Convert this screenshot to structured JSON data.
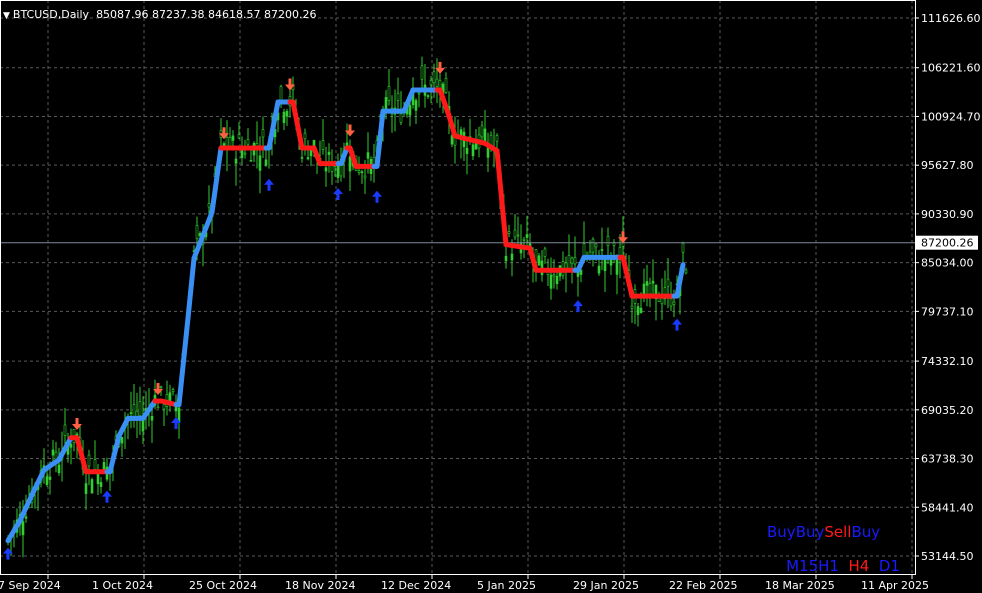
{
  "header": {
    "symbol": "BTCUSD,Daily",
    "ohlc": "85087.96 87237.38 84618.57 87200.26"
  },
  "colors": {
    "background": "#000000",
    "grid": "#5a5a5a",
    "candle": "#32cd32",
    "trend_up": "#3a8ff5",
    "trend_down": "#ff1a1a",
    "arrow_up": "#1a3aff",
    "arrow_down": "#ff6040",
    "axis_text": "#ffffff",
    "mtf_blue": "#1a1aff",
    "mtf_red": "#ff1a1a"
  },
  "mtf_panel": {
    "signals": [
      {
        "word": "Buy",
        "color": "#1a1aff"
      },
      {
        "word": "Buy",
        "color": "#1a1aff"
      },
      {
        "word": "Sell",
        "color": "#ff1a1a"
      },
      {
        "word": "Buy",
        "color": "#1a1aff"
      }
    ],
    "timeframes": [
      {
        "word": "M15",
        "color": "#1a1aff"
      },
      {
        "word": "H1",
        "color": "#1a1aff"
      },
      {
        "word": "  H4",
        "color": "#ff1a1a"
      },
      {
        "word": "  D1",
        "color": "#1a1aff"
      }
    ]
  },
  "chart_data": {
    "type": "candlestick",
    "title": "BTCUSD,Daily",
    "y_ticks": [
      111626.6,
      106221.6,
      100924.7,
      95627.8,
      90330.9,
      85034.0,
      79737.1,
      74332.1,
      69035.2,
      63738.3,
      58441.4,
      53144.5
    ],
    "y_tick_labels": [
      "111626.60",
      "106221.60",
      "100924.70",
      "95627.80",
      "90330.90",
      "85034.00",
      "79737.10",
      "74332.10",
      "69035.20",
      "63738.30",
      "58441.40",
      "53144.50"
    ],
    "x_labels": [
      "7 Sep 2024",
      "1 Oct 2024",
      "25 Oct 2024",
      "18 Nov 2024",
      "12 Dec 2024",
      "5 Jan 2025",
      "29 Jan 2025",
      "22 Feb 2025",
      "18 Mar 2025",
      "11 Apr 2025"
    ],
    "current_price": 87200.26,
    "current_price_label": "87200.26",
    "grid": true,
    "trend_line": [
      {
        "date": "2024-09-07",
        "value": 54800,
        "trend": "up"
      },
      {
        "date": "2024-09-11",
        "value": 57000,
        "trend": "up"
      },
      {
        "date": "2024-09-15",
        "value": 59800,
        "trend": "up"
      },
      {
        "date": "2024-09-19",
        "value": 62500,
        "trend": "up"
      },
      {
        "date": "2024-09-24",
        "value": 63600,
        "trend": "up"
      },
      {
        "date": "2024-09-28",
        "value": 66000,
        "trend": "up"
      },
      {
        "date": "2024-09-30",
        "value": 66000,
        "trend": "down"
      },
      {
        "date": "2024-10-03",
        "value": 62300,
        "trend": "down"
      },
      {
        "date": "2024-10-10",
        "value": 62300,
        "trend": "down"
      },
      {
        "date": "2024-10-11",
        "value": 62300,
        "trend": "up"
      },
      {
        "date": "2024-10-14",
        "value": 66200,
        "trend": "up"
      },
      {
        "date": "2024-10-17",
        "value": 68100,
        "trend": "up"
      },
      {
        "date": "2024-10-22",
        "value": 68100,
        "trend": "up"
      },
      {
        "date": "2024-10-26",
        "value": 70000,
        "trend": "up"
      },
      {
        "date": "2024-10-28",
        "value": 70000,
        "trend": "down"
      },
      {
        "date": "2024-11-02",
        "value": 69600,
        "trend": "down"
      },
      {
        "date": "2024-11-03",
        "value": 69600,
        "trend": "up"
      },
      {
        "date": "2024-11-06",
        "value": 79000,
        "trend": "up"
      },
      {
        "date": "2024-11-08",
        "value": 85500,
        "trend": "up"
      },
      {
        "date": "2024-11-11",
        "value": 88000,
        "trend": "up"
      },
      {
        "date": "2024-11-14",
        "value": 90500,
        "trend": "up"
      },
      {
        "date": "2024-11-17",
        "value": 97500,
        "trend": "up"
      },
      {
        "date": "2024-11-18",
        "value": 97500,
        "trend": "down"
      },
      {
        "date": "2024-12-02",
        "value": 97500,
        "trend": "down"
      },
      {
        "date": "2024-12-03",
        "value": 97500,
        "trend": "up"
      },
      {
        "date": "2024-12-06",
        "value": 102500,
        "trend": "up"
      },
      {
        "date": "2024-12-10",
        "value": 102500,
        "trend": "up"
      },
      {
        "date": "2024-12-11",
        "value": 102500,
        "trend": "down"
      },
      {
        "date": "2024-12-14",
        "value": 97500,
        "trend": "down"
      },
      {
        "date": "2024-12-18",
        "value": 97500,
        "trend": "down"
      },
      {
        "date": "2024-12-20",
        "value": 95800,
        "trend": "down"
      },
      {
        "date": "2024-12-26",
        "value": 95800,
        "trend": "down"
      },
      {
        "date": "2024-12-27",
        "value": 95800,
        "trend": "up"
      },
      {
        "date": "2024-12-29",
        "value": 97500,
        "trend": "up"
      },
      {
        "date": "2024-12-30",
        "value": 97500,
        "trend": "down"
      },
      {
        "date": "2025-01-01",
        "value": 95500,
        "trend": "down"
      },
      {
        "date": "2025-01-07",
        "value": 95500,
        "trend": "down"
      },
      {
        "date": "2025-01-08",
        "value": 95500,
        "trend": "up"
      },
      {
        "date": "2025-01-10",
        "value": 101500,
        "trend": "up"
      },
      {
        "date": "2025-01-17",
        "value": 101500,
        "trend": "up"
      },
      {
        "date": "2025-01-20",
        "value": 103800,
        "trend": "up"
      },
      {
        "date": "2025-01-28",
        "value": 103800,
        "trend": "up"
      },
      {
        "date": "2025-01-29",
        "value": 103800,
        "trend": "down"
      },
      {
        "date": "2025-02-01",
        "value": 101000,
        "trend": "down"
      },
      {
        "date": "2025-02-03",
        "value": 98800,
        "trend": "down"
      },
      {
        "date": "2025-02-13",
        "value": 98000,
        "trend": "down"
      },
      {
        "date": "2025-02-17",
        "value": 97200,
        "trend": "down"
      },
      {
        "date": "2025-02-20",
        "value": 87000,
        "trend": "down"
      },
      {
        "date": "2025-02-28",
        "value": 86600,
        "trend": "down"
      },
      {
        "date": "2025-03-02",
        "value": 84200,
        "trend": "down"
      },
      {
        "date": "2025-03-15",
        "value": 84200,
        "trend": "down"
      },
      {
        "date": "2025-03-16",
        "value": 84200,
        "trend": "up"
      },
      {
        "date": "2025-03-18",
        "value": 85600,
        "trend": "up"
      },
      {
        "date": "2025-03-30",
        "value": 85600,
        "trend": "up"
      },
      {
        "date": "2025-03-31",
        "value": 85600,
        "trend": "down"
      },
      {
        "date": "2025-04-03",
        "value": 81400,
        "trend": "down"
      },
      {
        "date": "2025-04-17",
        "value": 81400,
        "trend": "down"
      },
      {
        "date": "2025-04-18",
        "value": 81400,
        "trend": "up"
      },
      {
        "date": "2025-04-20",
        "value": 84800,
        "trend": "up"
      }
    ],
    "signals": [
      {
        "date": "2024-09-07",
        "type": "buy",
        "price": 53400
      },
      {
        "date": "2024-09-30",
        "type": "sell",
        "price": 67500
      },
      {
        "date": "2024-10-10",
        "type": "buy",
        "price": 59600
      },
      {
        "date": "2024-10-27",
        "type": "sell",
        "price": 71300
      },
      {
        "date": "2024-11-02",
        "type": "buy",
        "price": 67600
      },
      {
        "date": "2024-11-18",
        "type": "sell",
        "price": 99100
      },
      {
        "date": "2024-12-03",
        "type": "buy",
        "price": 93500
      },
      {
        "date": "2024-12-10",
        "type": "sell",
        "price": 104400
      },
      {
        "date": "2024-12-26",
        "type": "buy",
        "price": 92500
      },
      {
        "date": "2024-12-30",
        "type": "sell",
        "price": 99400
      },
      {
        "date": "2025-01-08",
        "type": "buy",
        "price": 92200
      },
      {
        "date": "2025-01-29",
        "type": "sell",
        "price": 106200
      },
      {
        "date": "2025-03-16",
        "type": "buy",
        "price": 80300
      },
      {
        "date": "2025-03-31",
        "type": "sell",
        "price": 87800
      },
      {
        "date": "2025-04-18",
        "type": "buy",
        "price": 78300
      }
    ]
  }
}
